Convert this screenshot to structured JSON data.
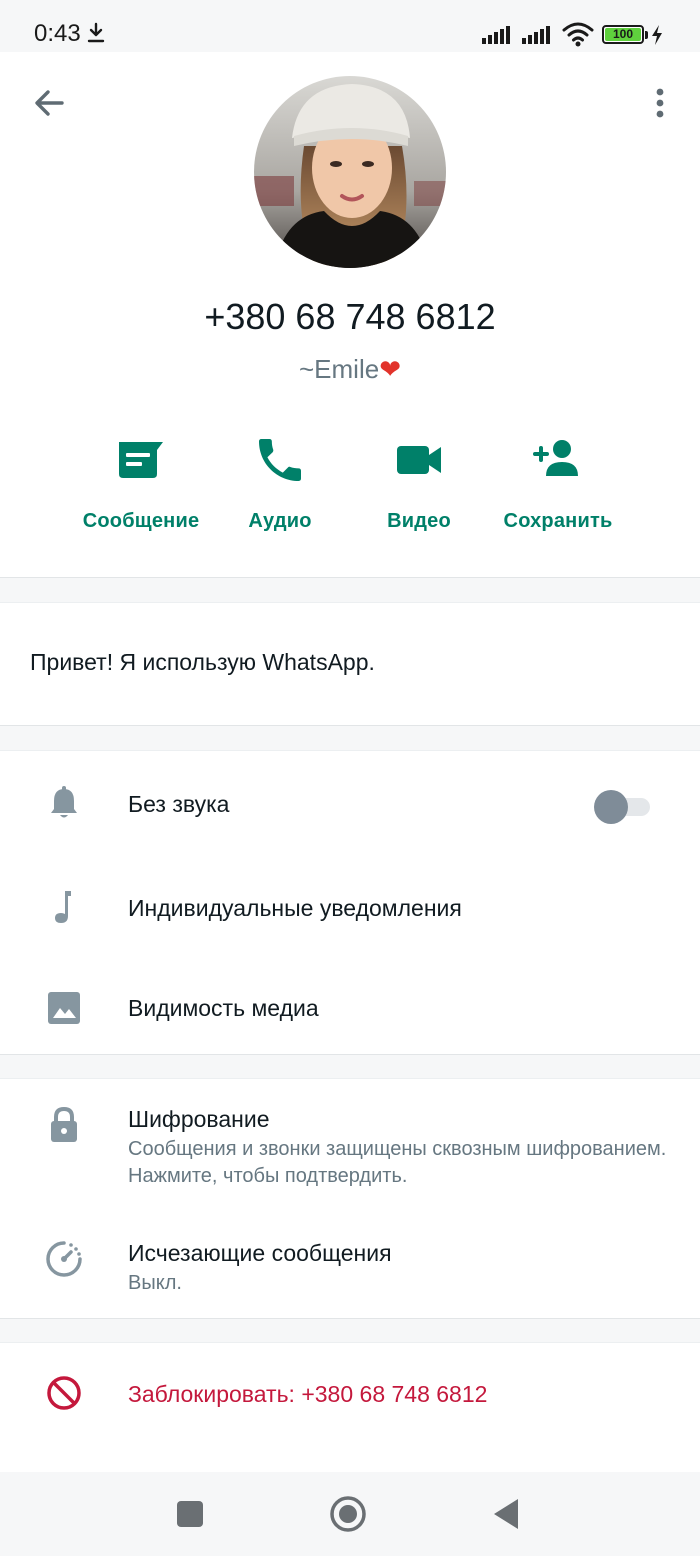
{
  "status_bar": {
    "time": "0:43",
    "battery": "100"
  },
  "contact": {
    "phone": "+380 68 748 6812",
    "push_name": "~Emile",
    "push_name_emoji": "❤"
  },
  "actions": [
    {
      "label": "Сообщение",
      "icon": "message-icon"
    },
    {
      "label": "Аудио",
      "icon": "phone-icon"
    },
    {
      "label": "Видео",
      "icon": "video-icon"
    },
    {
      "label": "Сохранить",
      "icon": "add-contact-icon"
    }
  ],
  "about": {
    "text": "Привет! Я использую WhatsApp."
  },
  "settings": {
    "mute": {
      "label": "Без звука",
      "enabled": false
    },
    "custom_notifications": {
      "label": "Индивидуальные уведомления"
    },
    "media_visibility": {
      "label": "Видимость медиа"
    }
  },
  "security": {
    "encryption": {
      "title": "Шифрование",
      "subtitle": "Сообщения и звонки защищены сквозным шифрованием. Нажмите, чтобы подтвердить."
    },
    "disappearing": {
      "title": "Исчезающие сообщения",
      "subtitle": "Выкл."
    }
  },
  "block": {
    "label": "Заблокировать: +380 68 748 6812"
  },
  "colors": {
    "accent": "#008069",
    "danger": "#c4183c",
    "icon_grey": "#8696a0",
    "background": "#f6f7f8"
  }
}
